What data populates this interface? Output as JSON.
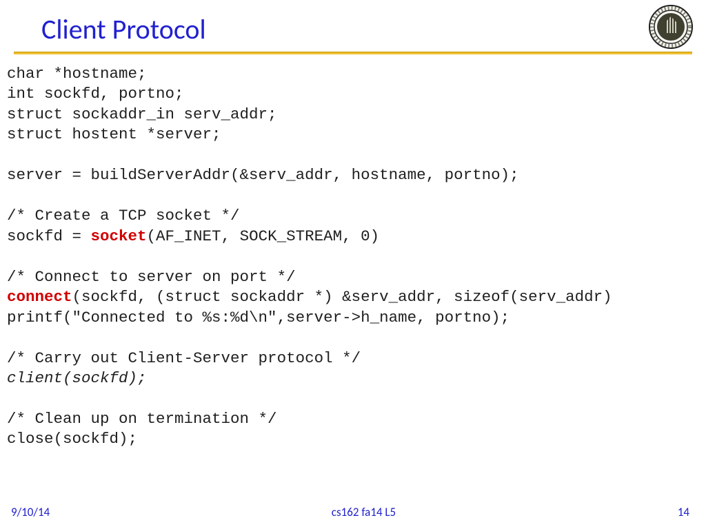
{
  "header": {
    "title": "Client Protocol",
    "logo_name": "university-seal-icon"
  },
  "code": {
    "line1": "char *hostname;",
    "line2": "int sockfd, portno;",
    "line3": "struct sockaddr_in serv_addr;",
    "line4": "struct hostent *server;",
    "blank1": "",
    "line5": "server = buildServerAddr(&serv_addr, hostname, portno);",
    "blank2": "",
    "line6": "/* Create a TCP socket */",
    "line7a": "sockfd = ",
    "line7kw": "socket",
    "line7b": "(AF_INET, SOCK_STREAM, 0)",
    "blank3": "",
    "line8": "/* Connect to server on port */",
    "line9kw": "connect",
    "line9b": "(sockfd, (struct sockaddr *) &serv_addr, sizeof(serv_addr)",
    "line10": "printf(\"Connected to %s:%d\\n\",server->h_name, portno);",
    "blank4": "",
    "line11": "/* Carry out Client-Server protocol */",
    "line12": "client(sockfd);",
    "blank5": "",
    "line13": "/* Clean up on termination */",
    "line14": "close(sockfd);"
  },
  "footer": {
    "date": "9/10/14",
    "course": "cs162 fa14 L5",
    "page": "14"
  }
}
